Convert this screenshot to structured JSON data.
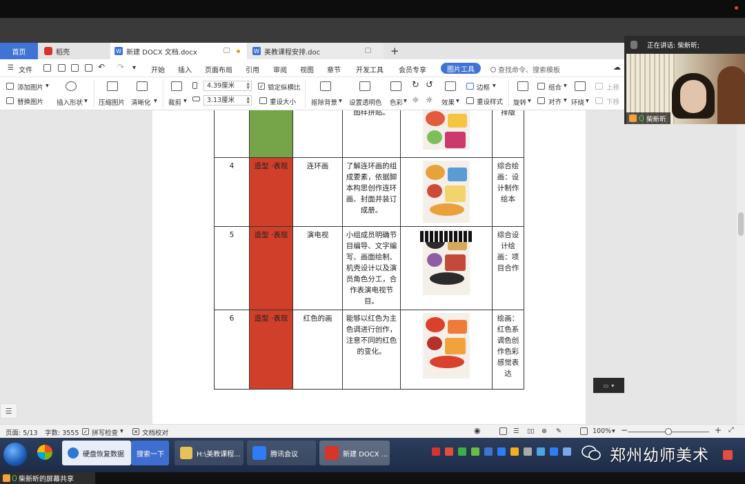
{
  "window": {
    "tabs": [
      {
        "label": "首页"
      },
      {
        "label": "稻壳"
      },
      {
        "label": "新建 DOCX 文档.docx"
      },
      {
        "label": "美教课程安排.doc"
      }
    ]
  },
  "menu": {
    "file": "文件",
    "items": [
      "开始",
      "插入",
      "页面布局",
      "引用",
      "审阅",
      "视图",
      "章节",
      "开发工具",
      "会员专享"
    ],
    "active_tool": "图片工具",
    "search": "查找命令、搜索模板"
  },
  "ribbon": {
    "add_picture": "添加图片",
    "replace_picture": "替换图片",
    "insert_shape": "插入形状",
    "compress": "压缩图片",
    "clarity": "清晰化",
    "crop": "裁剪",
    "width": "4.39厘米",
    "height": "3.13厘米",
    "lock_ratio": "锁定纵横比",
    "reset_size": "重设大小",
    "remove_bg": "抠除背景",
    "set_transparent": "设置透明色",
    "color": "色彩",
    "effects": "效果",
    "border": "边框",
    "reset_style": "重设样式",
    "rotate": "旋转",
    "group": "组合",
    "align": "对齐",
    "wrap": "环绕",
    "move_up": "上移",
    "move_down": "下移"
  },
  "table": {
    "rows": [
      {
        "no": "",
        "cat": "",
        "name": "",
        "goal": "图样拼贴。",
        "mode": "排版",
        "cat_color": "#76a448"
      },
      {
        "no": "4",
        "cat": "造型 ·表现",
        "name": "连环画",
        "goal": "了解连环画的组成要素，依据脚本构思创作连环画、封面并装订成册。",
        "mode": "综合绘画：设计制作绘本",
        "cat_color": "#cf3f2a"
      },
      {
        "no": "5",
        "cat": "造型 ·表现",
        "name": "演电视",
        "goal": "小组成员明确节目编导、文字编写、画面绘制、机壳设计以及演员角色分工，合作表演电视节目。",
        "mode": "综合设计绘画：项目合作",
        "cat_color": "#cf3f2a"
      },
      {
        "no": "6",
        "cat": "造型 ·表现",
        "name": "红色的画",
        "goal": "能够以红色为主色调进行创作，注意不同的红色的变化。",
        "mode": "绘画：红色系调色创作色彩感觉表达",
        "cat_color": "#cf3f2a"
      }
    ]
  },
  "status": {
    "page": "页面: 5/13",
    "words": "字数: 3555",
    "spell": "拼写检查",
    "proof": "文档校对",
    "zoom": "100%",
    "zoom_level": 0.5
  },
  "taskbar": {
    "items": [
      "硬盘恢复数据",
      "搜索一下",
      "H:\\美教课程...",
      "腾讯会议",
      "新建 DOCX ..."
    ],
    "watermark": "郑州幼师美术"
  },
  "share": {
    "label": "柴新昕的屏幕共享"
  },
  "video": {
    "speaking": "正在讲话: 柴新昕;",
    "name": "柴新昕"
  }
}
